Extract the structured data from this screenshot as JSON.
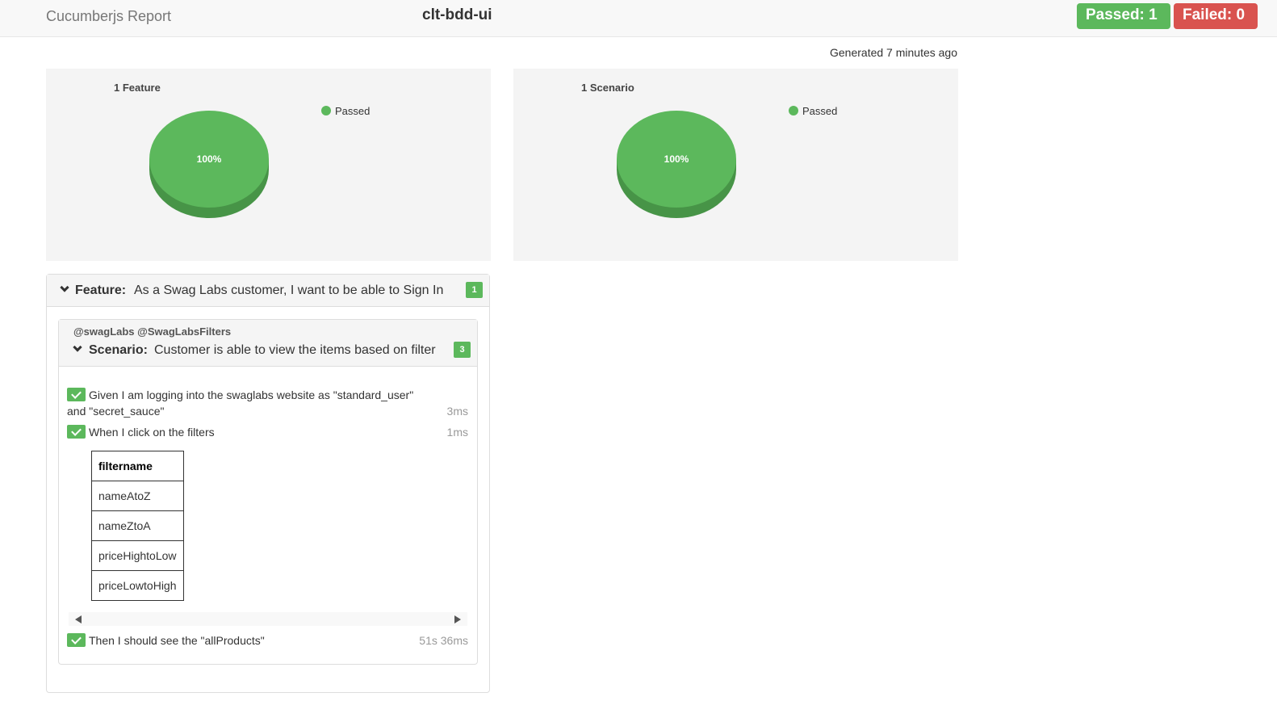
{
  "header": {
    "brand": "Cucumberjs Report",
    "project": "clt-bdd-ui",
    "passed_label": "Passed: 1",
    "failed_label": "Failed: 0"
  },
  "generated": "Generated 7 minutes ago",
  "colors": {
    "passed": "#5cb85c",
    "failed": "#d9534f"
  },
  "chart_data": [
    {
      "type": "pie",
      "title": "1 Feature",
      "categories": [
        "Passed"
      ],
      "values": [
        1
      ],
      "data_labels": [
        "100%"
      ],
      "legend": "top-right"
    },
    {
      "type": "pie",
      "title": "1 Scenario",
      "categories": [
        "Passed"
      ],
      "values": [
        1
      ],
      "data_labels": [
        "100%"
      ],
      "legend": "top-right"
    }
  ],
  "feature": {
    "keyword": "Feature:",
    "name": "As a Swag Labs customer, I want to be able to Sign In",
    "count": "1",
    "scenario": {
      "tags": "@swagLabs @SwagLabsFilters",
      "keyword": "Scenario:",
      "name": "Customer is able to view the items based on filter",
      "count": "3",
      "steps": [
        {
          "text": "Given I am logging into the swaglabs website as \"standard_user\" and \"secret_sauce\"",
          "duration": "3ms",
          "status": "passed"
        },
        {
          "text": "When I click on the filters",
          "duration": "1ms",
          "status": "passed"
        },
        {
          "text": "Then I should see the \"allProducts\"",
          "duration": "51s 36ms",
          "status": "passed"
        }
      ],
      "table": {
        "header": "filtername",
        "rows": [
          "nameAtoZ",
          "nameZtoA",
          "priceHightoLow",
          "priceLowtoHigh"
        ]
      }
    }
  }
}
